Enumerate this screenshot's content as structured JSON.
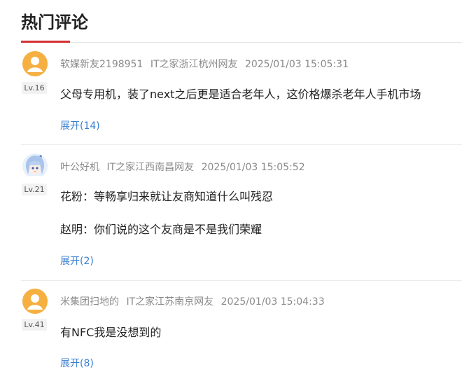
{
  "section": {
    "title": "热门评论",
    "accent_color": "#d43030"
  },
  "comments": [
    {
      "username": "软媒新友2198951",
      "location": "IT之家浙江杭州网友",
      "timestamp": "2025/01/03 15:05:31",
      "level": "Lv.16",
      "avatar_icon": "default-user-avatar-icon",
      "paragraphs": [
        "父母专用机，装了next之后更是适合老年人，这价格爆杀老年人手机市场"
      ],
      "expand_label": "展开(14)"
    },
    {
      "username": "叶公好机",
      "location": "IT之家江西南昌网友",
      "timestamp": "2025/01/03 15:05:52",
      "level": "Lv.21",
      "avatar_icon": "anime-character-avatar-icon",
      "paragraphs": [
        "花粉：等畅享归来就让友商知道什么叫残忍",
        "赵明：你们说的这个友商是不是我们荣耀"
      ],
      "expand_label": "展开(2)"
    },
    {
      "username": "米集团扫地的",
      "location": "IT之家江苏南京网友",
      "timestamp": "2025/01/03 15:04:33",
      "level": "Lv.41",
      "avatar_icon": "default-user-avatar-icon",
      "paragraphs": [
        "有NFC我是没想到的"
      ],
      "expand_label": "展开(8)"
    }
  ]
}
